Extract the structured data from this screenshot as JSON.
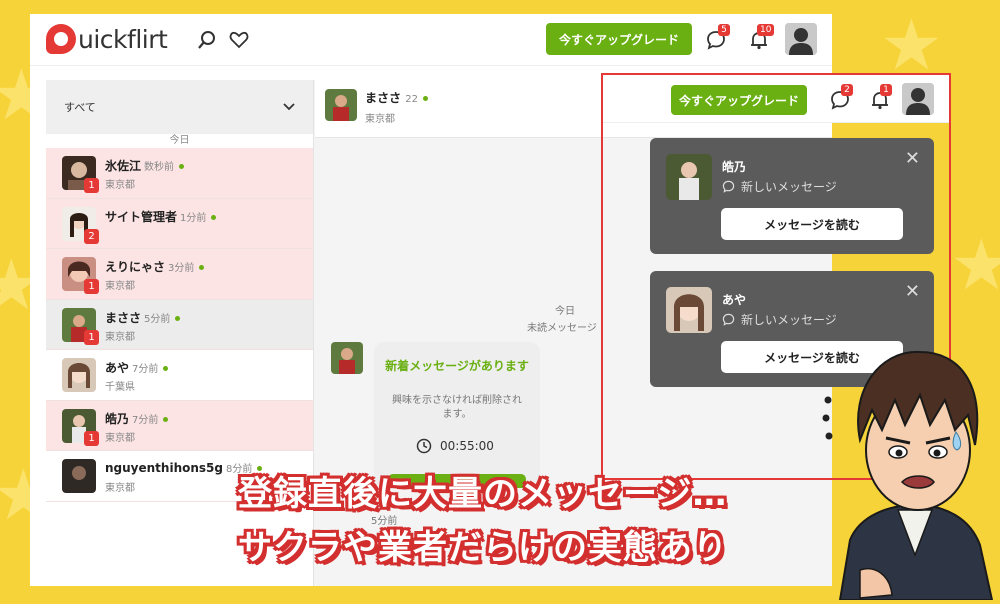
{
  "app": {
    "logo_text": "uickflirt",
    "brand_color": "#e53935",
    "accent_color": "#6ab012"
  },
  "header": {
    "upgrade_label": "今すぐアップグレード",
    "messages_badge": "5",
    "notifications_badge": "10",
    "icons": [
      "search-icon",
      "heart-icon",
      "chat-icon",
      "bell-icon",
      "user-avatar"
    ]
  },
  "sidebar": {
    "filter_value": "すべて",
    "date_separator": "今日",
    "conversations": [
      {
        "name": "氷佐江",
        "time": "数秒前",
        "location": "東京都",
        "unread": "1",
        "state": "unread"
      },
      {
        "name": "サイト管理者",
        "time": "1分前",
        "location": "",
        "unread": "2",
        "state": "unread"
      },
      {
        "name": "えりにゃさ",
        "time": "3分前",
        "location": "東京都",
        "unread": "1",
        "state": "unread"
      },
      {
        "name": "まささ",
        "time": "5分前",
        "location": "東京都",
        "unread": "1",
        "state": "selected"
      },
      {
        "name": "あや",
        "time": "7分前",
        "location": "千葉県",
        "unread": "",
        "state": "read"
      },
      {
        "name": "皓乃",
        "time": "7分前",
        "location": "東京都",
        "unread": "1",
        "state": "unread"
      },
      {
        "name": "nguyenthihons5g",
        "time": "8分前",
        "location": "東京都",
        "unread": "",
        "state": "read"
      }
    ]
  },
  "chat": {
    "partner_name": "まささ",
    "partner_age": "22",
    "partner_location": "東京都",
    "date_label": "今日",
    "unread_label": "未読メッセージ",
    "card_title": "新着メッセージがあります",
    "card_text": "興味を示さなければ削除されます。",
    "timer": "00:55:00",
    "footer_time": "5分前"
  },
  "overlay": {
    "upgrade_label": "今すぐアップグレード",
    "messages_badge": "2",
    "notifications_badge": "1",
    "toasts": [
      {
        "name": "皓乃",
        "message": "新しいメッセージ",
        "button": "メッセージを読む"
      },
      {
        "name": "あや",
        "message": "新しいメッセージ",
        "button": "メッセージを読む"
      }
    ]
  },
  "caption": {
    "line1": "登録直後に大量のメッセージ…",
    "line2": "サクラや業者だらけの実態あり"
  }
}
